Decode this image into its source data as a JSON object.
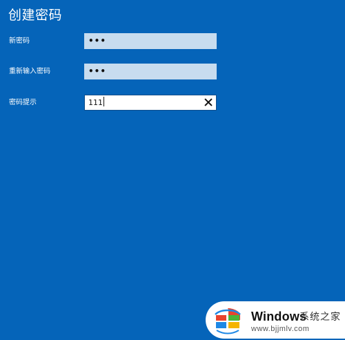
{
  "dialog": {
    "title": "创建密码",
    "new_password": {
      "label": "新密码",
      "value_masked": "•••"
    },
    "confirm_password": {
      "label": "重新输入密码",
      "value_masked": "•••"
    },
    "hint": {
      "label": "密码提示",
      "value": "111"
    }
  },
  "watermark": {
    "brand": "Windows",
    "cn_text": "系统之家",
    "url": "www.bjjmlv.com"
  },
  "colors": {
    "background": "#0564b9",
    "input_filled": "#c7dcef",
    "input_focused": "#ffffff",
    "text": "#ffffff",
    "logo_red": "#e8432e",
    "logo_green": "#4ab43a",
    "logo_blue": "#1e88e5",
    "logo_yellow": "#f5b400"
  }
}
